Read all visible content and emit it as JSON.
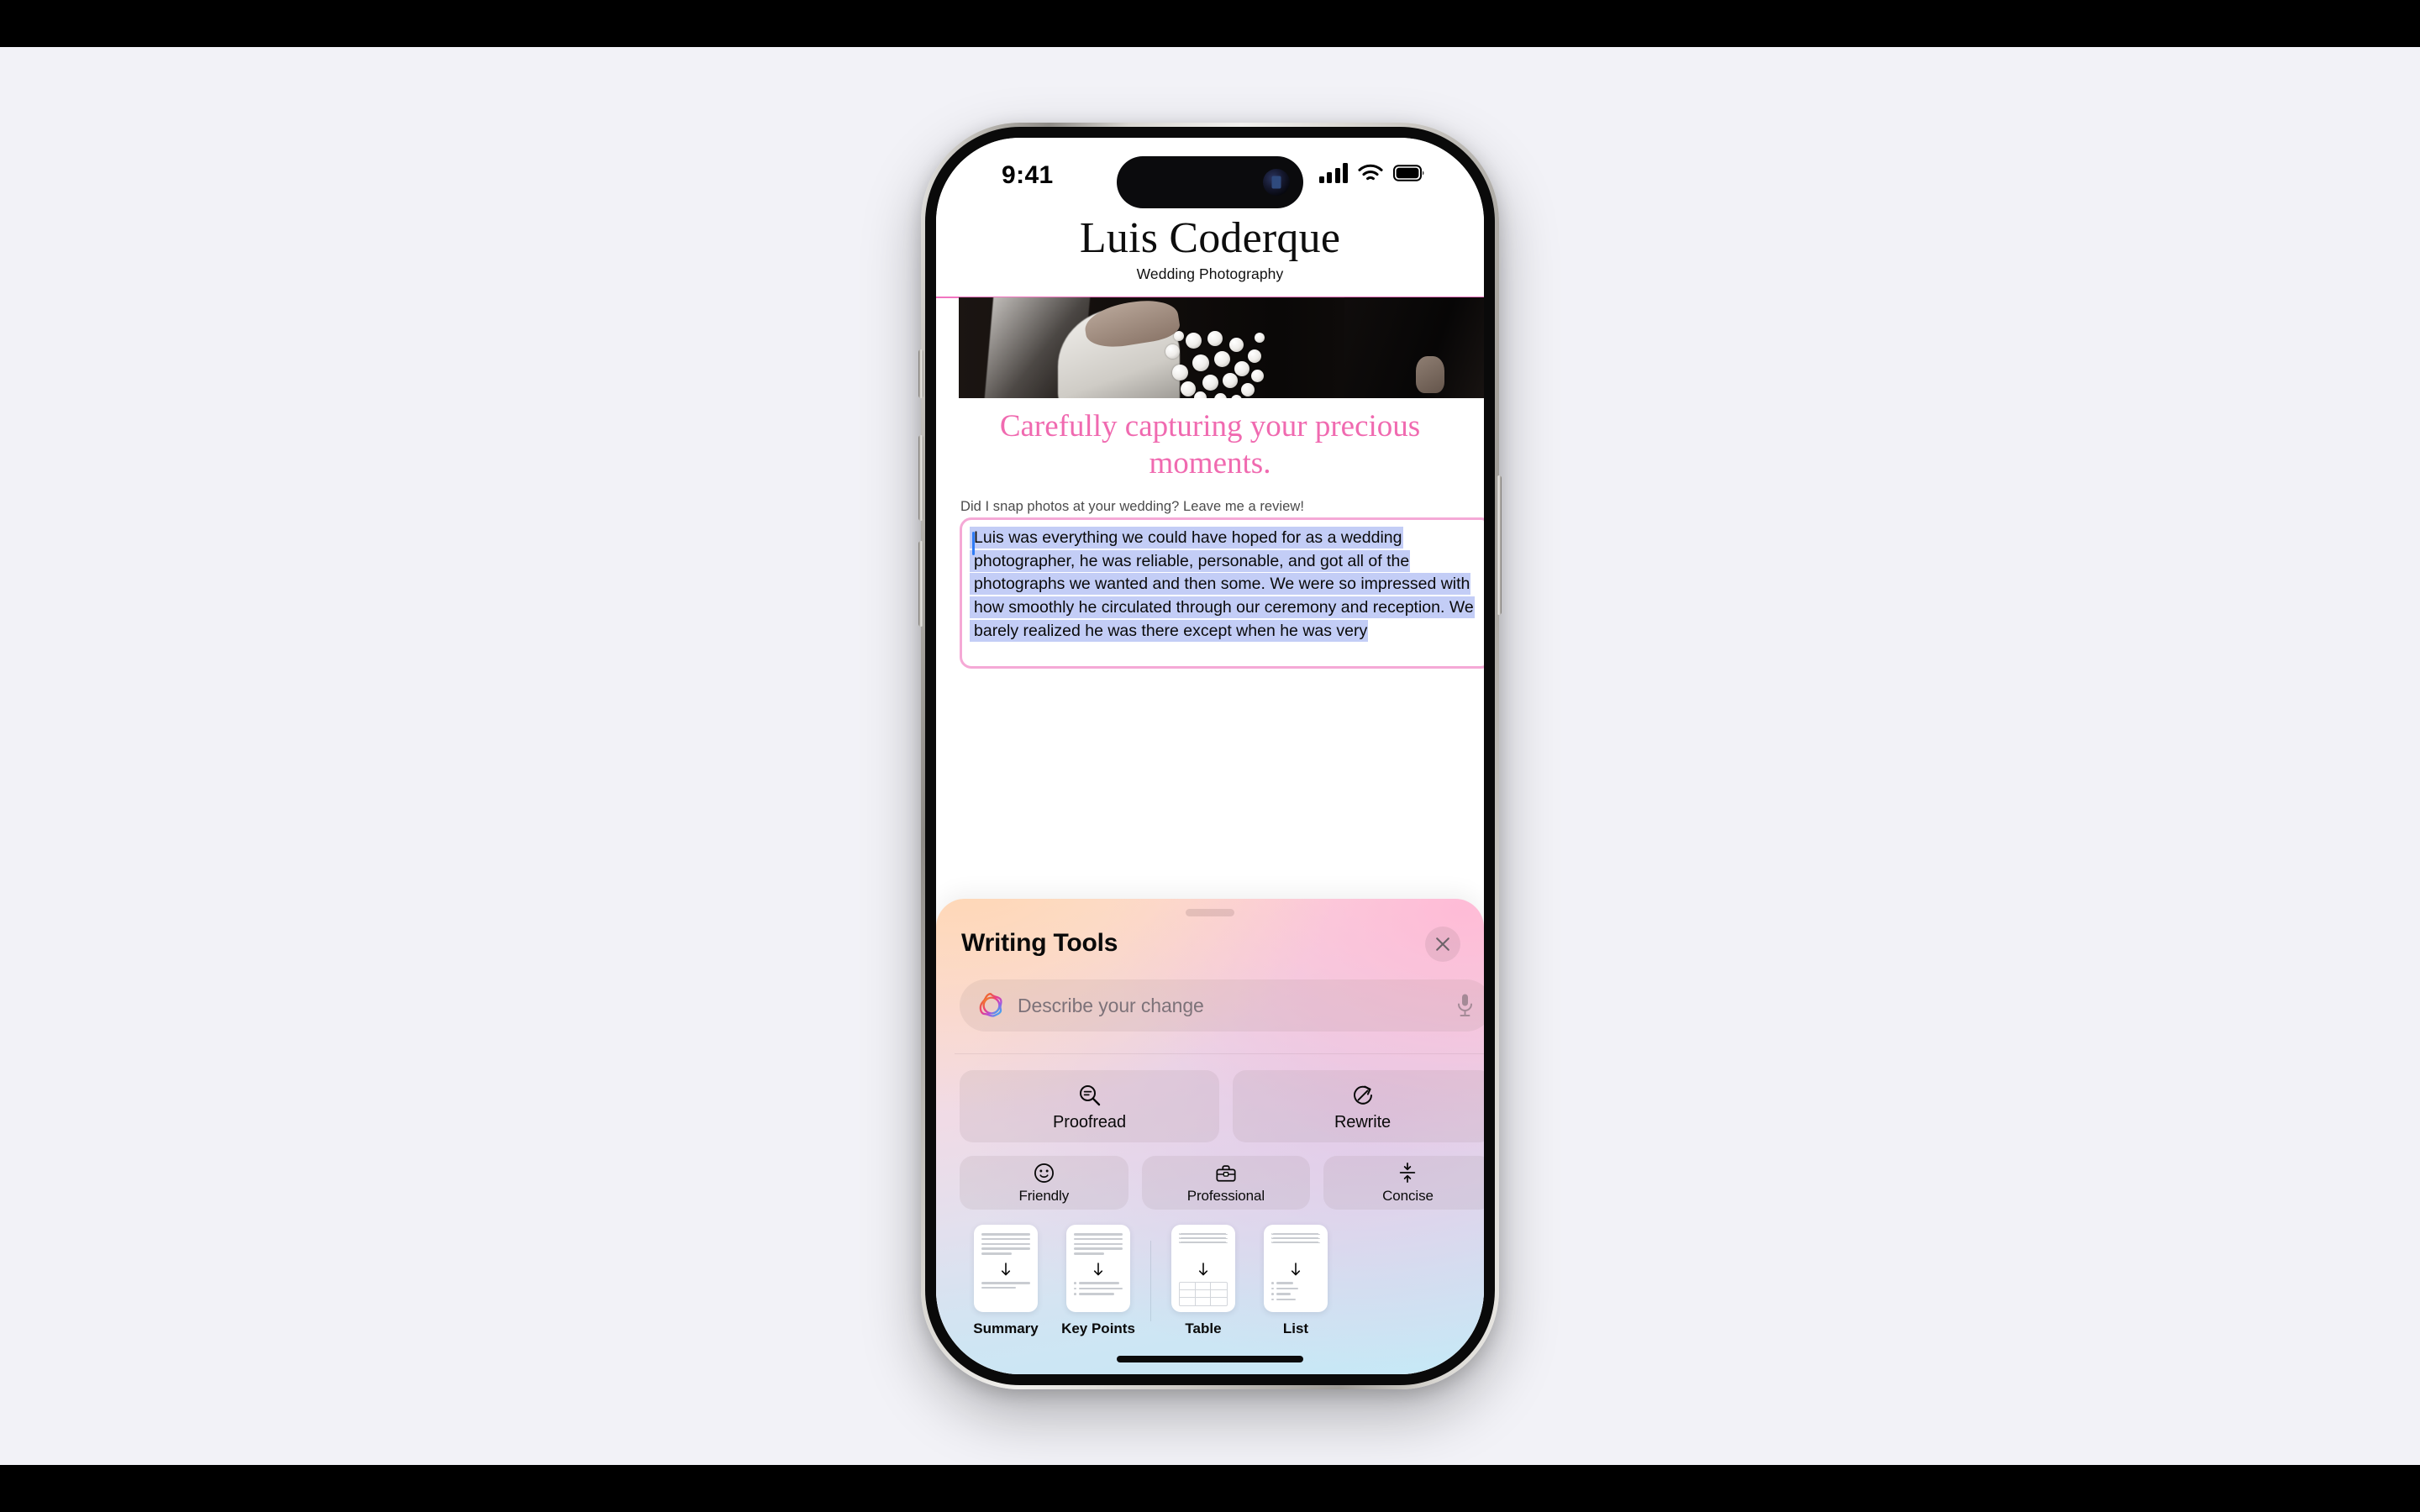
{
  "status_bar": {
    "time": "9:41",
    "cellular_icon": "cellular-bars-icon",
    "wifi_icon": "wifi-icon",
    "battery_icon": "battery-full-icon"
  },
  "website": {
    "logo_title": "Luis Coderque",
    "logo_subtitle": "Wedding Photography",
    "tagline": "Carefully capturing your precious moments.",
    "review_prompt": "Did I snap photos at your wedding? Leave me a review!",
    "review_text": "Luis was everything we could have hoped for as a wedding photographer, he was reliable, personable, and got all of the photographs we wanted and then some. We were so impressed with how smoothly he circulated through our ceremony and reception. We barely realized he was there except when he was very",
    "accent_pink": "#f175c0",
    "tagline_color": "#f06ab0",
    "selection_color": "#c3cdf6",
    "caret_color": "#2f7cf6"
  },
  "writing_tools": {
    "title": "Writing Tools",
    "close_label": "Close",
    "close_icon": "close-icon",
    "grabber": "drag-handle",
    "input": {
      "placeholder": "Describe your change",
      "value": "",
      "leading_icon": "apple-intelligence-icon",
      "trailing_icon": "microphone-icon"
    },
    "main_actions": [
      {
        "label": "Proofread",
        "icon": "proofread-magnifier-icon"
      },
      {
        "label": "Rewrite",
        "icon": "rewrite-circular-arrow-icon"
      }
    ],
    "tone_actions": [
      {
        "label": "Friendly",
        "icon": "smiley-face-icon"
      },
      {
        "label": "Professional",
        "icon": "briefcase-icon"
      },
      {
        "label": "Concise",
        "icon": "compress-arrows-icon"
      }
    ],
    "document_actions": [
      {
        "label": "Summary",
        "icon": "summary-document-icon"
      },
      {
        "label": "Key Points",
        "icon": "key-points-document-icon"
      },
      {
        "label": "Table",
        "icon": "table-document-icon"
      },
      {
        "label": "List",
        "icon": "list-document-icon"
      }
    ],
    "gradient_start": "#fbe2d9",
    "gradient_mid": "#f0dbe6",
    "gradient_end": "#c6e8f6"
  },
  "device": {
    "home_indicator": "home-indicator",
    "dynamic_island": "dynamic-island",
    "buttons": [
      "action-button",
      "volume-up-button",
      "volume-down-button",
      "power-button"
    ]
  }
}
